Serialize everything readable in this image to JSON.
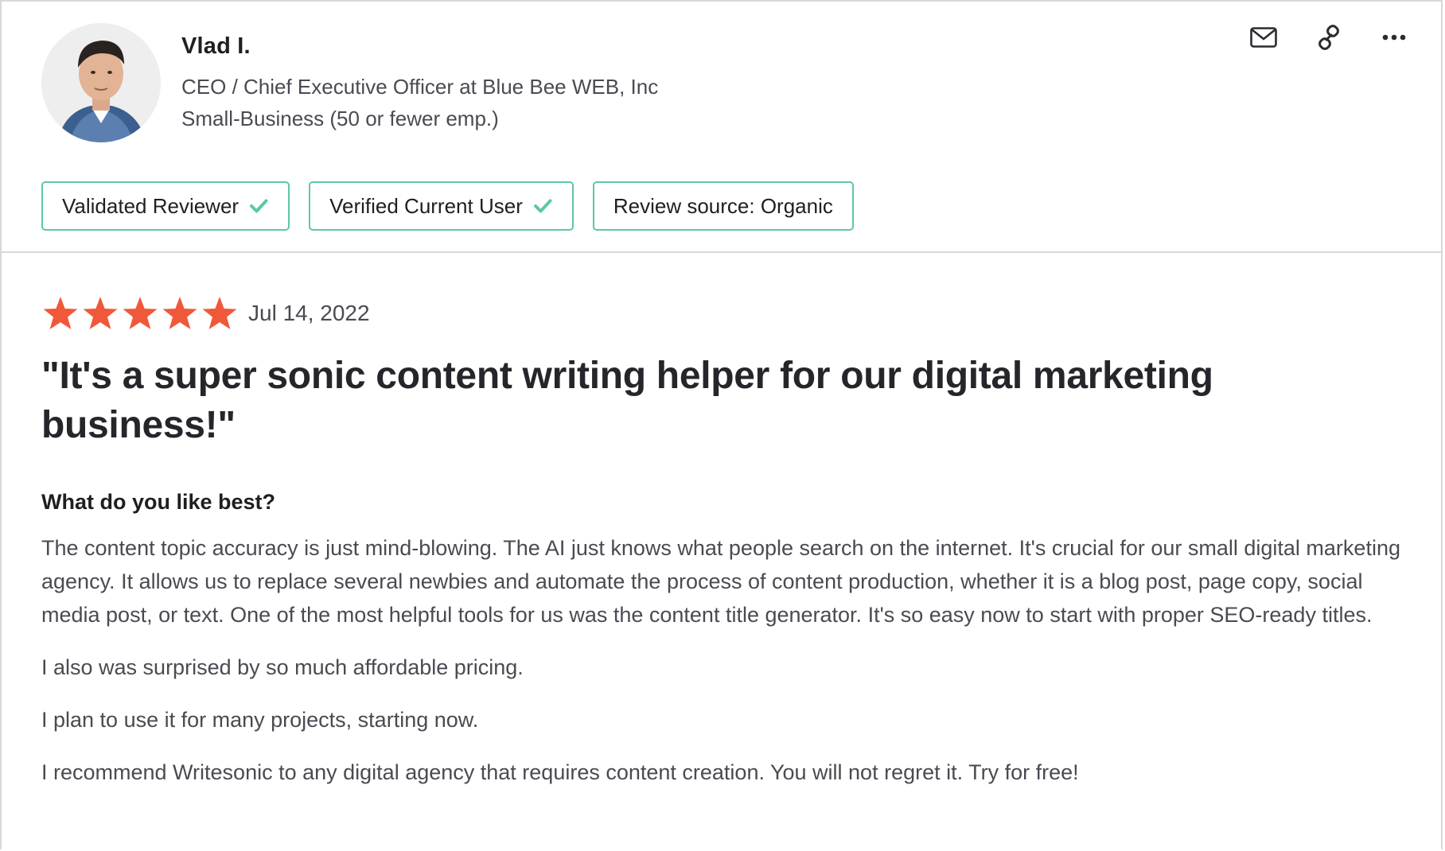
{
  "reviewer": {
    "name": "Vlad I.",
    "title": "CEO / Chief Executive Officer at Blue Bee WEB, Inc",
    "company_size": "Small-Business (50 or fewer emp.)",
    "avatar_icon": "person-photo"
  },
  "actions": {
    "email_icon": "mail-icon",
    "link_icon": "link-icon",
    "more_icon": "more-icon"
  },
  "badges": [
    {
      "label": "Validated Reviewer",
      "checked": true
    },
    {
      "label": "Verified Current User",
      "checked": true
    },
    {
      "label": "Review source: Organic",
      "checked": false
    }
  ],
  "review": {
    "rating": 5,
    "max_rating": 5,
    "date": "Jul 14, 2022",
    "headline": "\"It's a super sonic content writing helper for our digital marketing business!\"",
    "question": "What do you like best?",
    "paragraphs": [
      "The content topic accuracy is just mind-blowing. The AI just knows what people search on the internet. It's crucial for our small digital marketing agency. It allows us to replace several newbies and automate the process of content production, whether it is a blog post, page copy, social media post, or text. One of the most helpful tools for us was the content title generator. It's so easy now to start with proper SEO-ready titles.",
      "I also was surprised by so much affordable pricing.",
      "I plan to use it for many projects, starting now.",
      "I recommend Writesonic to any digital agency that requires content creation. You will not regret it. Try for free!"
    ]
  },
  "colors": {
    "star": "#f0583a",
    "badge_border": "#5bc8a7",
    "check": "#5bc8a7",
    "divider": "#d8d8d8",
    "text_primary": "#1f1f22",
    "text_secondary": "#4a4a52"
  }
}
